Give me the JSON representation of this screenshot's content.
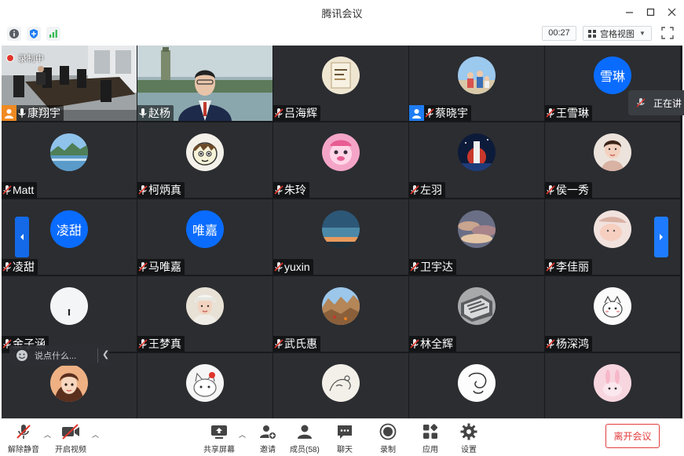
{
  "window": {
    "title": "腾讯会议"
  },
  "infobar": {
    "timer": "00:27",
    "view_mode": "宫格视图"
  },
  "recording": {
    "label": "录制中"
  },
  "speaking": {
    "label": "正在讲"
  },
  "chat": {
    "placeholder": "说点什么..."
  },
  "participants": [
    {
      "name": "康翔宇",
      "type": "video1",
      "role": "host",
      "muted": false
    },
    {
      "name": "赵杨",
      "type": "video2",
      "muted": false
    },
    {
      "name": "吕海辉",
      "type": "img",
      "avatar": "book-cover",
      "muted": true
    },
    {
      "name": "蔡晓宇",
      "type": "img",
      "avatar": "family-photo",
      "role": "cohost",
      "muted": true
    },
    {
      "name": "王雪琳",
      "type": "text",
      "avatar_text": "雪琳",
      "muted": true
    },
    {
      "name": "Matt",
      "type": "img",
      "avatar": "lake-landscape",
      "muted": true
    },
    {
      "name": "柯炳真",
      "type": "img",
      "avatar": "cartoon-character",
      "muted": true
    },
    {
      "name": "朱玲",
      "type": "img",
      "avatar": "pink-cartoon",
      "muted": true
    },
    {
      "name": "左羽",
      "type": "img",
      "avatar": "night-photo",
      "muted": true
    },
    {
      "name": "侯一秀",
      "type": "img",
      "avatar": "woman-portrait",
      "muted": true
    },
    {
      "name": "凌甜",
      "type": "text",
      "avatar_text": "凌甜",
      "muted": true
    },
    {
      "name": "马唯嘉",
      "type": "text",
      "avatar_text": "唯嘉",
      "muted": true
    },
    {
      "name": "yuxin",
      "type": "img",
      "avatar": "sunset-sky",
      "muted": true
    },
    {
      "name": "卫宇达",
      "type": "img",
      "avatar": "cloud-sky",
      "muted": true
    },
    {
      "name": "李佳丽",
      "type": "img",
      "avatar": "pastel-photo",
      "muted": true
    },
    {
      "name": "金子涵",
      "type": "img",
      "avatar": "white-snow",
      "muted": true
    },
    {
      "name": "王梦真",
      "type": "img",
      "avatar": "girl-selfie",
      "muted": true
    },
    {
      "name": "武氏惠",
      "type": "img",
      "avatar": "rocky-landscape",
      "muted": true
    },
    {
      "name": "林全辉",
      "type": "img",
      "avatar": "gray-object",
      "muted": true
    },
    {
      "name": "杨深鸿",
      "type": "img",
      "avatar": "cute-sketch",
      "muted": true
    },
    {
      "name": "",
      "type": "img",
      "avatar": "girl-cartoon",
      "muted": true
    },
    {
      "name": "",
      "type": "img",
      "avatar": "cat-cartoon",
      "muted": true
    },
    {
      "name": "",
      "type": "img",
      "avatar": "sketch-drawing",
      "muted": true
    },
    {
      "name": "",
      "type": "img",
      "avatar": "line-doodle",
      "muted": true
    },
    {
      "name": "",
      "type": "img",
      "avatar": "pink-bunny",
      "muted": true
    }
  ],
  "toolbar": {
    "unmute": "解除静音",
    "video": "开启视频",
    "share": "共享屏幕",
    "invite": "邀请",
    "members": "成员(58)",
    "chat": "聊天",
    "record": "录制",
    "apps": "应用",
    "settings": "设置",
    "leave": "离开会议"
  },
  "colors": {
    "accent": "#0a6cff",
    "leave": "#e23c3c",
    "host": "#f08a22",
    "cohost": "#1f7cf2"
  }
}
